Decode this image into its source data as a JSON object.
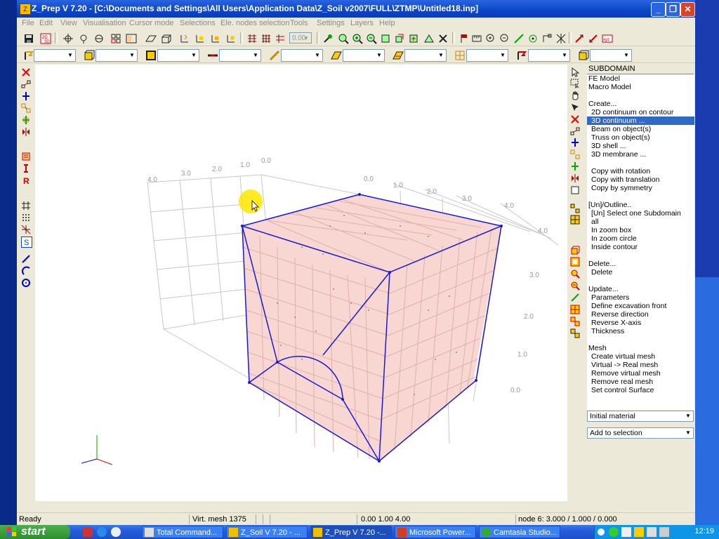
{
  "window": {
    "title": "Z_Prep V 7.20 - [C:\\Documents and Settings\\All Users\\Application Data\\Z_Soil v2007\\FULL\\ZTMP\\Untitled18.inp]",
    "app_icon_text": "Z"
  },
  "menu": [
    "File",
    "Edit",
    "View",
    "Visualisation",
    "Cursor mode",
    "Selections",
    "Ele. nodes selection",
    "Tools",
    "Settings",
    "Layers",
    "Help"
  ],
  "toolbar": {
    "zoom_combo_value": "0.00"
  },
  "viewport": {
    "axis_labels_left": [
      "4.0",
      "3.0",
      "2.0",
      "1.0",
      "0.0"
    ],
    "axis_labels_top": [
      "0.0",
      "1.0",
      "2.0",
      "3.0",
      "4.0"
    ],
    "axis_labels_right": [
      "4.0",
      "3.0",
      "2.0",
      "1.0",
      "0.0"
    ]
  },
  "panel": {
    "header": "SUBDOMAIN",
    "items": [
      {
        "label": "FE Model",
        "indent": false,
        "selected": false
      },
      {
        "label": "Macro Model",
        "indent": false,
        "selected": false
      },
      {
        "label": "",
        "indent": false,
        "selected": false
      },
      {
        "label": "Create...",
        "indent": false,
        "selected": false
      },
      {
        "label": "2D continuum on contour",
        "indent": true,
        "selected": false
      },
      {
        "label": "3D continuum ...",
        "indent": true,
        "selected": true
      },
      {
        "label": "Beam on object(s)",
        "indent": true,
        "selected": false
      },
      {
        "label": "Truss on object(s)",
        "indent": true,
        "selected": false
      },
      {
        "label": "3D shell ...",
        "indent": true,
        "selected": false
      },
      {
        "label": "3D membrane ...",
        "indent": true,
        "selected": false
      },
      {
        "label": "",
        "indent": false,
        "selected": false
      },
      {
        "label": "Copy with rotation",
        "indent": true,
        "selected": false
      },
      {
        "label": "Copy with translation",
        "indent": true,
        "selected": false
      },
      {
        "label": "Copy by symmetry",
        "indent": true,
        "selected": false
      },
      {
        "label": "",
        "indent": false,
        "selected": false
      },
      {
        "label": "[Un]/Outline..",
        "indent": false,
        "selected": false
      },
      {
        "label": "[Un] Select one Subdomain",
        "indent": true,
        "selected": false
      },
      {
        "label": "all",
        "indent": true,
        "selected": false
      },
      {
        "label": "In zoom box",
        "indent": true,
        "selected": false
      },
      {
        "label": "In zoom circle",
        "indent": true,
        "selected": false
      },
      {
        "label": "Inside contour",
        "indent": true,
        "selected": false
      },
      {
        "label": "",
        "indent": false,
        "selected": false
      },
      {
        "label": "Delete...",
        "indent": false,
        "selected": false
      },
      {
        "label": "Delete",
        "indent": true,
        "selected": false
      },
      {
        "label": "",
        "indent": false,
        "selected": false
      },
      {
        "label": "Update...",
        "indent": false,
        "selected": false
      },
      {
        "label": "Parameters",
        "indent": true,
        "selected": false
      },
      {
        "label": "Define excavation front",
        "indent": true,
        "selected": false
      },
      {
        "label": "Reverse direction",
        "indent": true,
        "selected": false
      },
      {
        "label": "Reverse X-axis",
        "indent": true,
        "selected": false
      },
      {
        "label": "Thickness",
        "indent": true,
        "selected": false
      },
      {
        "label": "",
        "indent": false,
        "selected": false
      },
      {
        "label": "Mesh",
        "indent": false,
        "selected": false
      },
      {
        "label": "Create virtual mesh",
        "indent": true,
        "selected": false
      },
      {
        "label": "Virtual -> Real mesh",
        "indent": true,
        "selected": false
      },
      {
        "label": "Remove virtual mesh",
        "indent": true,
        "selected": false
      },
      {
        "label": "Remove real mesh",
        "indent": true,
        "selected": false
      },
      {
        "label": "Set control Surface",
        "indent": true,
        "selected": false
      }
    ],
    "material_select": "Initial material",
    "selection_mode_select": "Add to selection"
  },
  "status": {
    "state": "Ready",
    "mesh": "Virt. mesh 1375",
    "coords": "0.00  1.00  4.00",
    "node": "node 6:  3.000 / 1.000 / 0.000"
  },
  "taskbar": {
    "start_label": "start",
    "tasks": [
      {
        "label": "Total Command...",
        "active": false
      },
      {
        "label": "Z_Soil V 7.20 - ...",
        "active": false
      },
      {
        "label": "Z_Prep V 7.20 -...",
        "active": true
      },
      {
        "label": "Microsoft Power...",
        "active": false
      },
      {
        "label": "Camtasia Studio...",
        "active": false
      }
    ],
    "clock": "12:19"
  }
}
